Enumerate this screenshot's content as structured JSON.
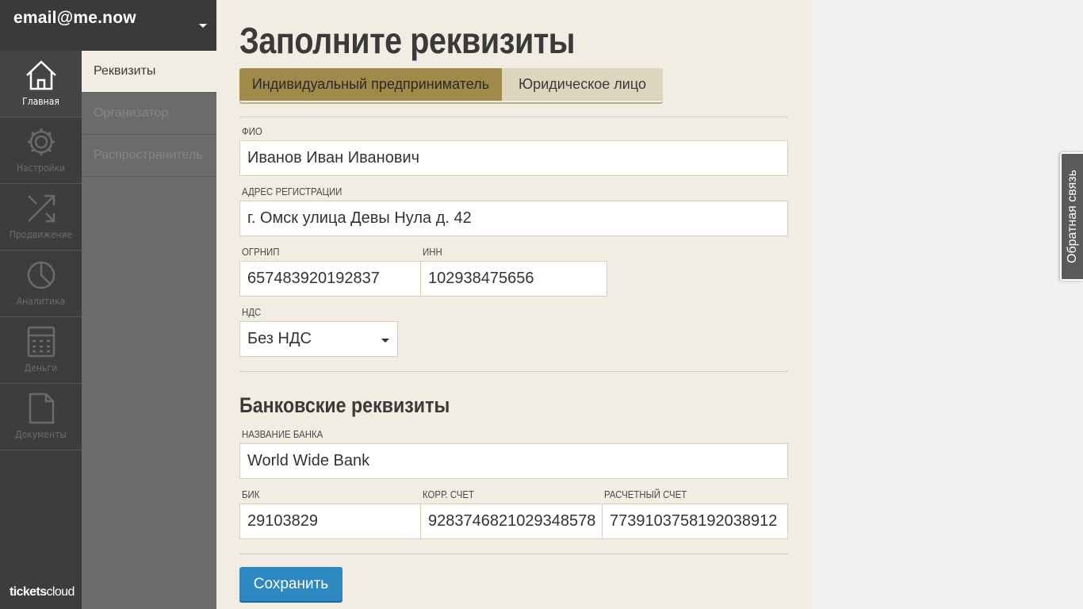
{
  "account": {
    "email": "email@me.now"
  },
  "rail": {
    "items": [
      {
        "label": "Главная",
        "icon": "home-icon",
        "active": true
      },
      {
        "label": "Настройки",
        "icon": "gear-icon",
        "active": false
      },
      {
        "label": "Продвижение",
        "icon": "arrows-icon",
        "active": false
      },
      {
        "label": "Аналитика",
        "icon": "pie-chart-icon",
        "active": false
      },
      {
        "label": "Деньги",
        "icon": "calculator-icon",
        "active": false
      },
      {
        "label": "Документы",
        "icon": "document-icon",
        "active": false
      }
    ],
    "brand_bold": "tickets",
    "brand_rest": "cloud"
  },
  "submenu": {
    "items": [
      {
        "label": "Реквизиты",
        "active": true
      },
      {
        "label": "Организатор",
        "active": false
      },
      {
        "label": "Распространитель",
        "active": false
      }
    ]
  },
  "main": {
    "title": "Заполните реквизиты",
    "tabs": [
      {
        "label": "Индивидуальный предприниматель",
        "active": true
      },
      {
        "label": "Юридическое лицо",
        "active": false
      }
    ],
    "fio": {
      "label": "ФИО",
      "value": "Иванов Иван Иванович"
    },
    "address": {
      "label": "Адрес регистрации",
      "value": "г. Омск улица Девы Нула д. 42"
    },
    "ogrnip": {
      "label": "ОГРНИП",
      "value": "657483920192837"
    },
    "inn": {
      "label": "ИНН",
      "value": "102938475656"
    },
    "nds": {
      "label": "НДС",
      "value": "Без НДС"
    },
    "bank_section_title": "Банковские реквизиты",
    "bank_name": {
      "label": "Название банка",
      "value": "World Wide Bank"
    },
    "bik": {
      "label": "БИК",
      "value": "29103829"
    },
    "korr": {
      "label": "Корр. счет",
      "value": "9283746821029348578"
    },
    "raschet": {
      "label": "Расчетный счет",
      "value": "7739103758192038912"
    },
    "save_label": "Сохранить"
  },
  "feedback_label": "Обратная связь",
  "colors": {
    "accent": "#2d88c2",
    "tab_active": "#a08a4a",
    "tab_inactive": "#ddd5bd",
    "main_bg": "#f1ede3",
    "rail_bg": "#3d3d3d"
  }
}
